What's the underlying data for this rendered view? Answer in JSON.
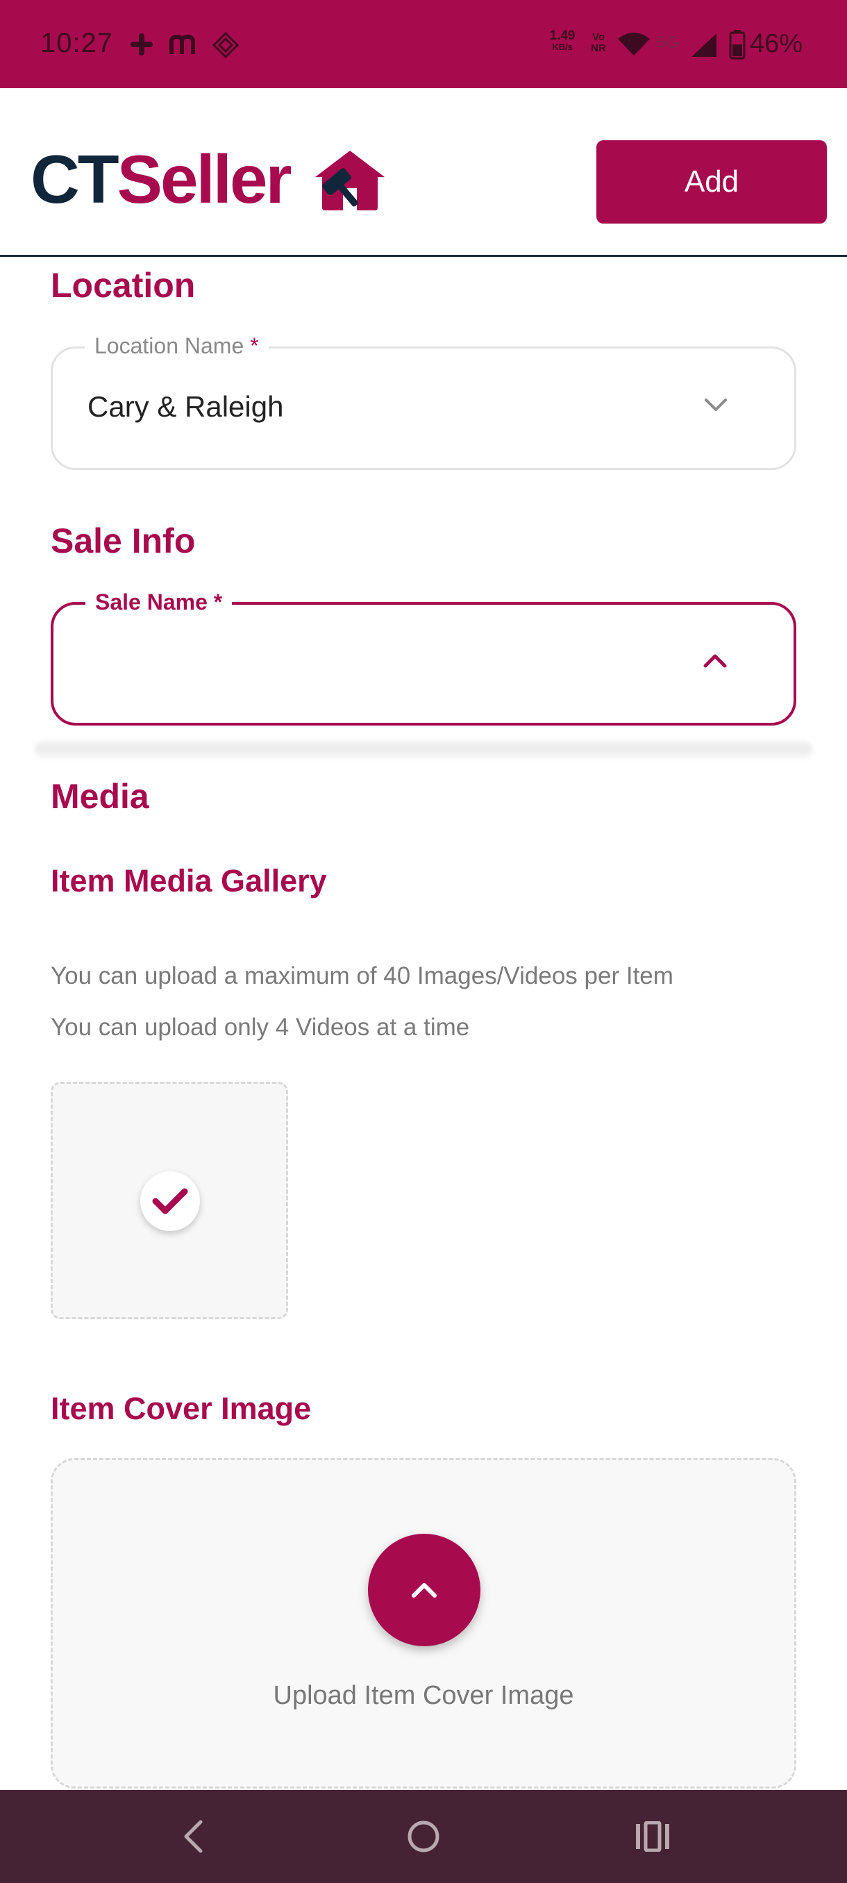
{
  "status_bar": {
    "time": "10:27",
    "icons": [
      "slack-icon",
      "m-app-icon",
      "diamond-app-icon",
      "network-speed-icon",
      "volte-icon",
      "wifi-icon",
      "5g-icon",
      "signal-icon",
      "battery-icon"
    ],
    "network_speed": "1.49",
    "network_speed_unit": "KB/s",
    "volte_top": "Vo",
    "volte_bottom": "NR",
    "fiveg": "5G",
    "battery": "46%"
  },
  "header": {
    "logo_ct": "CT",
    "logo_seller": "Seller",
    "add_label": "Add"
  },
  "location": {
    "title": "Location",
    "field_label": "Location Name",
    "required_mark": "*",
    "value": "Cary & Raleigh"
  },
  "sale_info": {
    "title": "Sale Info",
    "field_label": "Sale Name",
    "required_mark": "*",
    "value": ""
  },
  "media": {
    "title": "Media",
    "gallery_title": "Item Media Gallery",
    "info_max": "You can upload a maximum of 40 Images/Videos per Item",
    "info_videos": "You can upload only 4 Videos at a time",
    "cover_title": "Item Cover Image",
    "cover_upload_label": "Upload Item Cover Image"
  },
  "colors": {
    "accent": "#a80a4e",
    "logo_dark": "#11263a",
    "navbar": "#452334"
  }
}
